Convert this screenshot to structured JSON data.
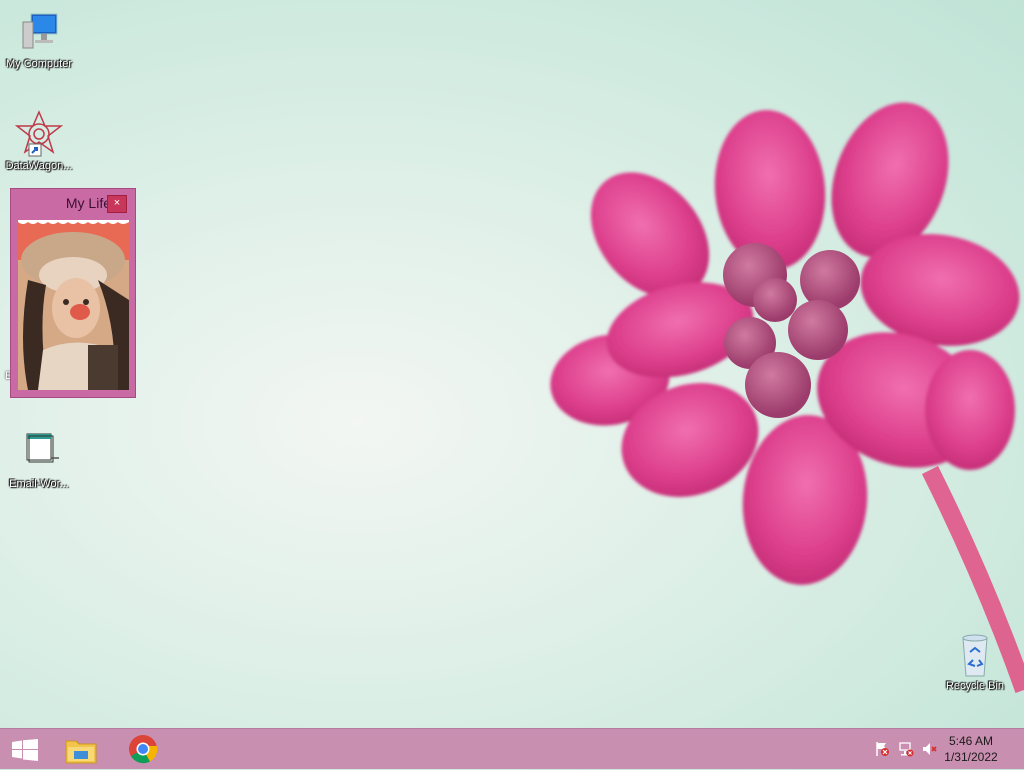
{
  "desktop": {
    "icons": [
      {
        "label": "My Computer",
        "icon": "computer-icon"
      },
      {
        "label": "DataWagon...",
        "icon": "datawagon-icon"
      },
      {
        "label": "Email-Wor...",
        "icon": "window-app-icon"
      },
      {
        "label": "Recycle Bin",
        "icon": "recycle-bin-icon"
      }
    ],
    "partial_icon_letter": "E"
  },
  "gadget": {
    "title": "My Life",
    "close_label": "×"
  },
  "taskbar": {
    "apps": [
      {
        "name": "start",
        "icon": "windows-logo-icon"
      },
      {
        "name": "file-explorer",
        "icon": "folder-icon"
      },
      {
        "name": "chrome",
        "icon": "chrome-icon"
      }
    ],
    "clock": {
      "time": "5:46 AM",
      "date": "1/31/2022"
    }
  },
  "colors": {
    "taskbar": "#c98fb0",
    "gadget": "#c96aa4",
    "flower": "#e0428f"
  }
}
